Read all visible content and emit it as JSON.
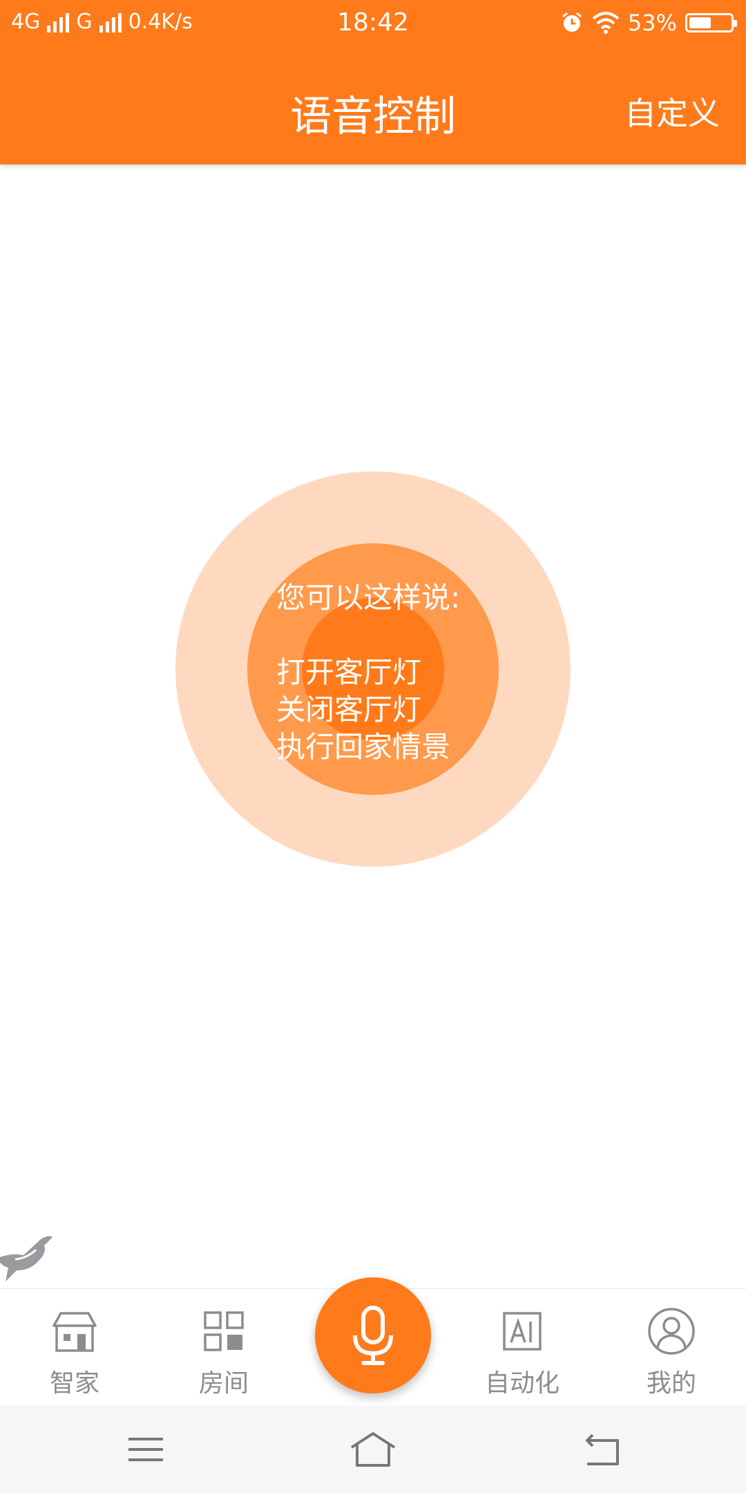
{
  "status_bar": {
    "network1": "4G",
    "network2": "G",
    "speed": "0.4K/s",
    "time": "18:42",
    "battery_text": "53%",
    "battery_level": 0.53
  },
  "header": {
    "title": "语音控制",
    "action_label": "自定义"
  },
  "hint": {
    "intro": "您可以这样说:",
    "examples": [
      "打开客厅灯",
      "关闭客厅灯",
      "执行回家情景"
    ]
  },
  "tabs": [
    {
      "label": "智家",
      "icon": "house-icon"
    },
    {
      "label": "房间",
      "icon": "grid-icon"
    },
    {
      "label": "自动化",
      "icon": "ai-icon"
    },
    {
      "label": "我的",
      "icon": "profile-icon"
    }
  ],
  "center_button_icon": "microphone-icon",
  "colors": {
    "accent": "#FF7A1A",
    "ring_outer": "#FFD9BF",
    "ring_middle": "#FF9A4C",
    "tab_inactive": "#8C8C8C"
  }
}
